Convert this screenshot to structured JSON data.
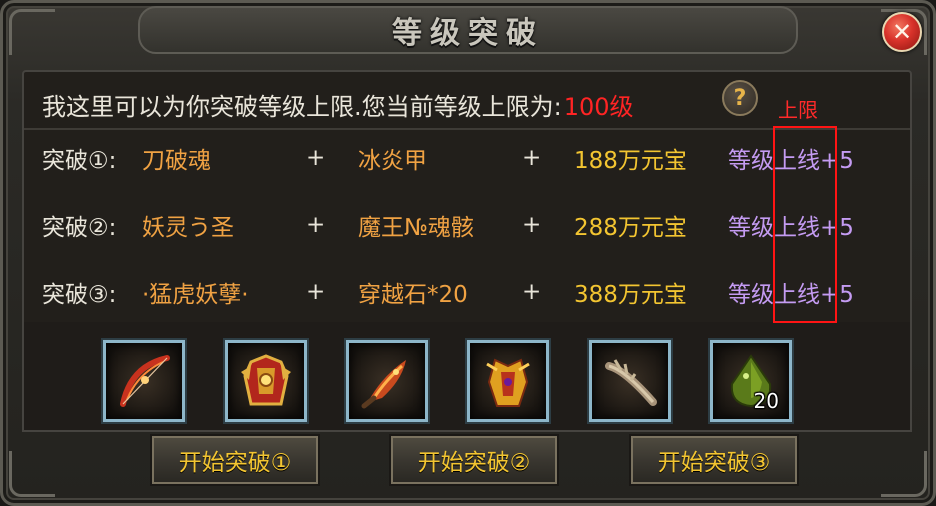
{
  "window": {
    "title": "等级突破",
    "close_label": "✕"
  },
  "intro": {
    "text": "我这里可以为你突破等级上限.您当前等级上限为:",
    "level": "100级",
    "help_label": "?"
  },
  "plus_sign": "+",
  "rows": [
    {
      "label": "突破①:",
      "item1": "刀破魂",
      "item2": "冰炎甲",
      "cost": "188万元宝",
      "bonus": "等级上线+5"
    },
    {
      "label": "突破②:",
      "item1": "妖灵う圣",
      "item2": "魔王№魂骸",
      "cost": "288万元宝",
      "bonus": "等级上线+5"
    },
    {
      "label": "突破③:",
      "item1": "·猛虎妖孽·",
      "item2": "穿越石*20",
      "cost": "388万元宝",
      "bonus": "等级上线+5"
    }
  ],
  "annotation": {
    "label": "上限",
    "color": "#ff1414"
  },
  "slots": [
    {
      "icon": "red-bow-icon"
    },
    {
      "icon": "gold-armor-icon"
    },
    {
      "icon": "fire-blade-icon"
    },
    {
      "icon": "demon-armor-icon"
    },
    {
      "icon": "bone-weapon-icon"
    },
    {
      "icon": "green-stone-icon",
      "quantity": "20"
    }
  ],
  "buttons": [
    {
      "label": "开始突破①"
    },
    {
      "label": "开始突破②"
    },
    {
      "label": "开始突破③"
    }
  ],
  "colors": {
    "text": "#e9e5da",
    "item": "#f0a243",
    "cost": "#f3c531",
    "bonus": "#c49bf2",
    "level": "#ff2424"
  }
}
